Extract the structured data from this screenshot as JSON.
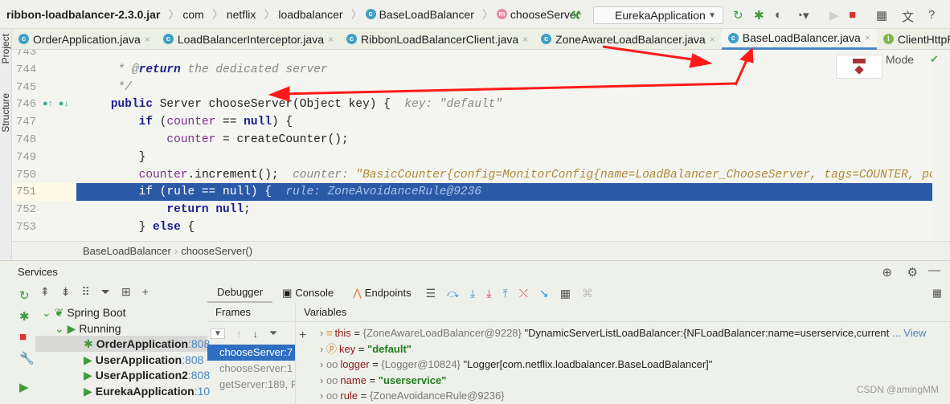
{
  "navbar": {
    "crumbs": [
      "ribbon-loadbalancer-2.3.0.jar",
      "com",
      "netflix",
      "loadbalancer",
      "BaseLoadBalancer",
      "chooseServer"
    ],
    "run_config": "EurekaApplication"
  },
  "tabs": [
    {
      "label": "OrderApplication.java"
    },
    {
      "label": "LoadBalancerInterceptor.java"
    },
    {
      "label": "RibbonLoadBalancerClient.java"
    },
    {
      "label": "ZoneAwareLoadBalancer.java"
    },
    {
      "label": "BaseLoadBalancer.java",
      "active": true
    },
    {
      "label": "ClientHttpRequ"
    }
  ],
  "side": {
    "project": "Project",
    "structure": "Structure"
  },
  "editor": {
    "mode_label": "Mode",
    "lines": [
      {
        "n": "743",
        "text": "     *"
      },
      {
        "n": "744",
        "text": "     * @return the dedicated server"
      },
      {
        "n": "745",
        "text": "     */"
      },
      {
        "n": "746",
        "text": "    public Server chooseServer(Object key) {",
        "hint": "key: \"default\""
      },
      {
        "n": "747",
        "text": "        if (counter == null) {"
      },
      {
        "n": "748",
        "text": "            counter = createCounter();"
      },
      {
        "n": "749",
        "text": "        }"
      },
      {
        "n": "750",
        "text": "        counter.increment();",
        "hint": "counter: ",
        "hintv": "\"BasicCounter{config=MonitorConfig{name=LoadBalancer_ChooseServer, tags=COUNTER, po"
      },
      {
        "n": "751",
        "text": "        if (rule == null) {",
        "hint": "rule: ZoneAvoidanceRule@9236",
        "current": true
      },
      {
        "n": "752",
        "text": "            return null;"
      },
      {
        "n": "753",
        "text": "        } else {"
      }
    ]
  },
  "breadcrumb2": [
    "BaseLoadBalancer",
    "chooseServer()"
  ],
  "services": {
    "title": "Services",
    "tree": [
      {
        "label": "Spring Boot"
      },
      {
        "label": "Running"
      },
      {
        "label": "OrderApplication",
        "port": ":808"
      },
      {
        "label": "UserApplication",
        "port": ":808"
      },
      {
        "label": "UserApplication2",
        "port": ":808"
      },
      {
        "label": "EurekaApplication",
        "port": ":10"
      }
    ],
    "debug_tabs": [
      "Debugger",
      "Console",
      "Endpoints"
    ],
    "frames_header": "Frames",
    "variables_header": "Variables",
    "frames": [
      "chooseServer:7",
      "chooseServer:1",
      "getServer:189, R"
    ],
    "variables": [
      {
        "name": "this",
        "value": "{ZoneAwareLoadBalancer@9228}",
        "extra": "\"DynamicServerListLoadBalancer:{NFLoadBalancer:name=userservice,current",
        "link": "... View"
      },
      {
        "name": "key",
        "str": "\"default\""
      },
      {
        "name": "logger",
        "value": "{Logger@10824}",
        "extra": "\"Logger[com.netflix.loadbalancer.BaseLoadBalancer]\""
      },
      {
        "name": "name",
        "str": "\"userservice\""
      },
      {
        "name": "rule",
        "value": "{ZoneAvoidanceRule@9236}"
      }
    ]
  },
  "watermark": "CSDN @amingMM",
  "colors": {
    "accent": "#2a5aa5",
    "annotation_arrow": "#ff1a1a"
  }
}
